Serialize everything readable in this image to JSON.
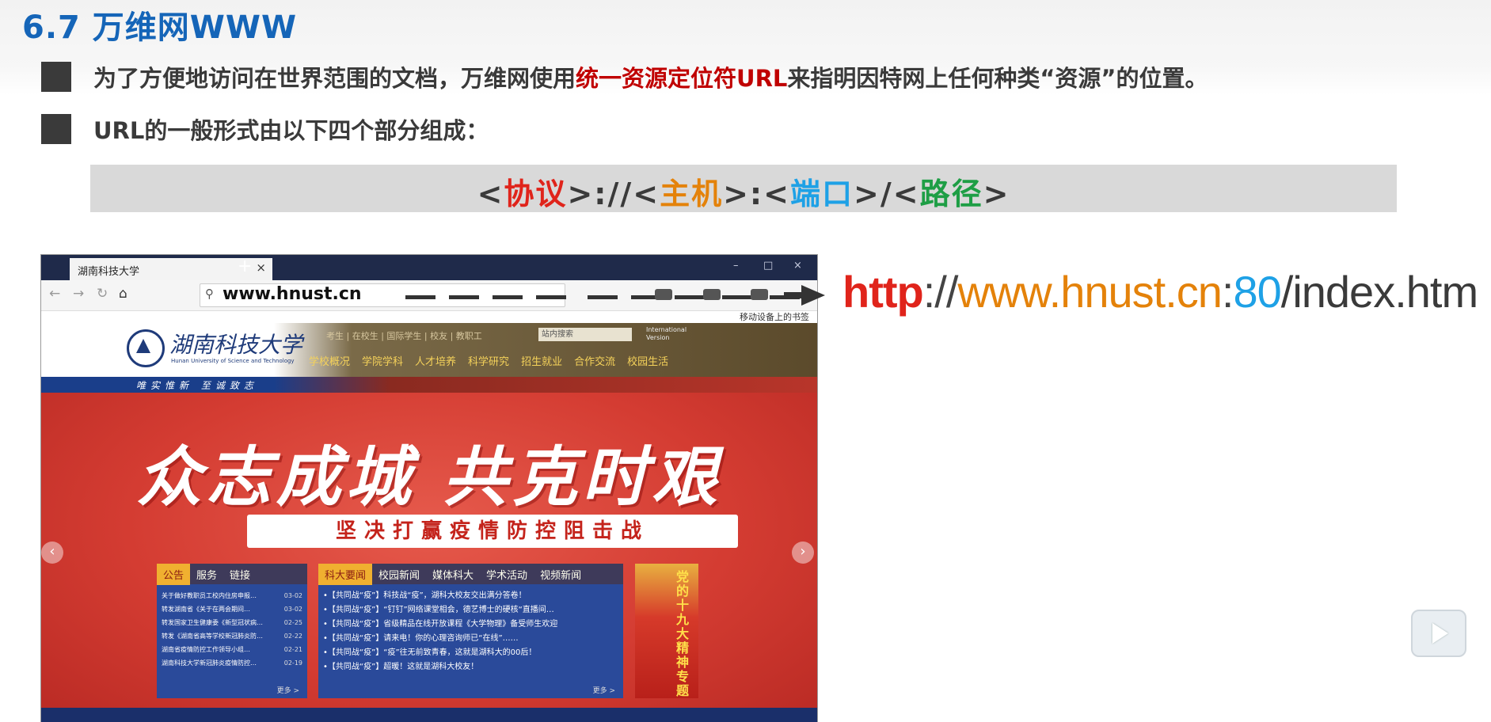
{
  "slide": {
    "title": "6.7 万维网WWW",
    "bullet1": {
      "before": "为了方便地访问在世界范围的文档，万维网使用",
      "keyword": "统一资源定位符URL",
      "after": "来指明因特网上任何种类“资源”的位置。"
    },
    "bullet2": "URL的一般形式由以下四个部分组成：",
    "url_form": {
      "lt1": "<",
      "protocol": "协议",
      "sep1": ">://<",
      "host": "主机",
      "sep2": ">:<",
      "port": "端口",
      "sep3": ">/<",
      "path": "路径",
      "gt": ">"
    }
  },
  "browser": {
    "tab_title": "湖南科技大学",
    "tab_close": "×",
    "new_tab": "+",
    "window_controls": [
      "–",
      "□",
      "×"
    ],
    "nav": {
      "back": "←",
      "forward": "→",
      "reload": "↻",
      "home": "⌂"
    },
    "address_icon": "⚲",
    "address": "www.hnust.cn",
    "bookmark_label": "移动设备上的书签"
  },
  "site": {
    "logo_cn": "湖南科技大学",
    "logo_en": "Hunan University of Science and Technology",
    "quick_links": "考生 | 在校生 | 国际学生 | 校友 | 教职工",
    "search_placeholder": "站内搜索",
    "intl": "International Version",
    "main_nav": [
      "学校概况",
      "学院学科",
      "人才培养",
      "科学研究",
      "招生就业",
      "合作交流",
      "校园生活"
    ],
    "slogan": "唯实惟新  至诚致志",
    "hero_title": "众志成城 共克时艰",
    "hero_sub": "坚决打赢疫情防控阻击战",
    "prev": "‹",
    "next": "›",
    "notice_tabs": [
      "公告",
      "服务",
      "链接"
    ],
    "notices": [
      {
        "text": "关于做好教职员工校内住房申报…",
        "date": "03-02"
      },
      {
        "text": "转发湖南省《关于在两会期间…",
        "date": "03-02"
      },
      {
        "text": "转发国家卫生健康委《新型冠状病…",
        "date": "02-25"
      },
      {
        "text": "转发《湖南省高等学校新冠肺炎防…",
        "date": "02-22"
      },
      {
        "text": "湖南省疫情防控工作领导小组…",
        "date": "02-21"
      },
      {
        "text": "湖南科技大学新冠肺炎疫情防控…",
        "date": "02-19"
      }
    ],
    "news_tabs": [
      "科大要闻",
      "校园新闻",
      "媒体科大",
      "学术活动",
      "视频新闻"
    ],
    "news": [
      "•【共同战“疫”】科技战“疫”，湖科大校友交出满分答卷！",
      "•【共同战“疫”】“钉钉”网络课堂相会，德艺博士的硬核“直播间…",
      "•【共同战“疫”】省级精品在线开放课程《大学物理》备受师生欢迎",
      "•【共同战“疫”】请来电！你的心理咨询师已“在线”……",
      "•【共同战“疫”】“疫”往无前致青春，这就是湖科大的00后！",
      "•【共同战“疫”】超暖！这就是湖科大校友！"
    ],
    "more": "更多 >",
    "party_banner": "党的十九大精神专题"
  },
  "url_example": {
    "protocol": "http",
    "sep1": "://",
    "host": "www.hnust.cn",
    "sep2": ":",
    "port": "80",
    "path": "/index.htm"
  },
  "colors": {
    "title_blue": "#1565b8",
    "keyword_red": "#c00000",
    "protocol_red": "#e0241b",
    "host_orange": "#e4820a",
    "port_blue": "#1ea1e6",
    "path_green": "#1e9e45"
  }
}
